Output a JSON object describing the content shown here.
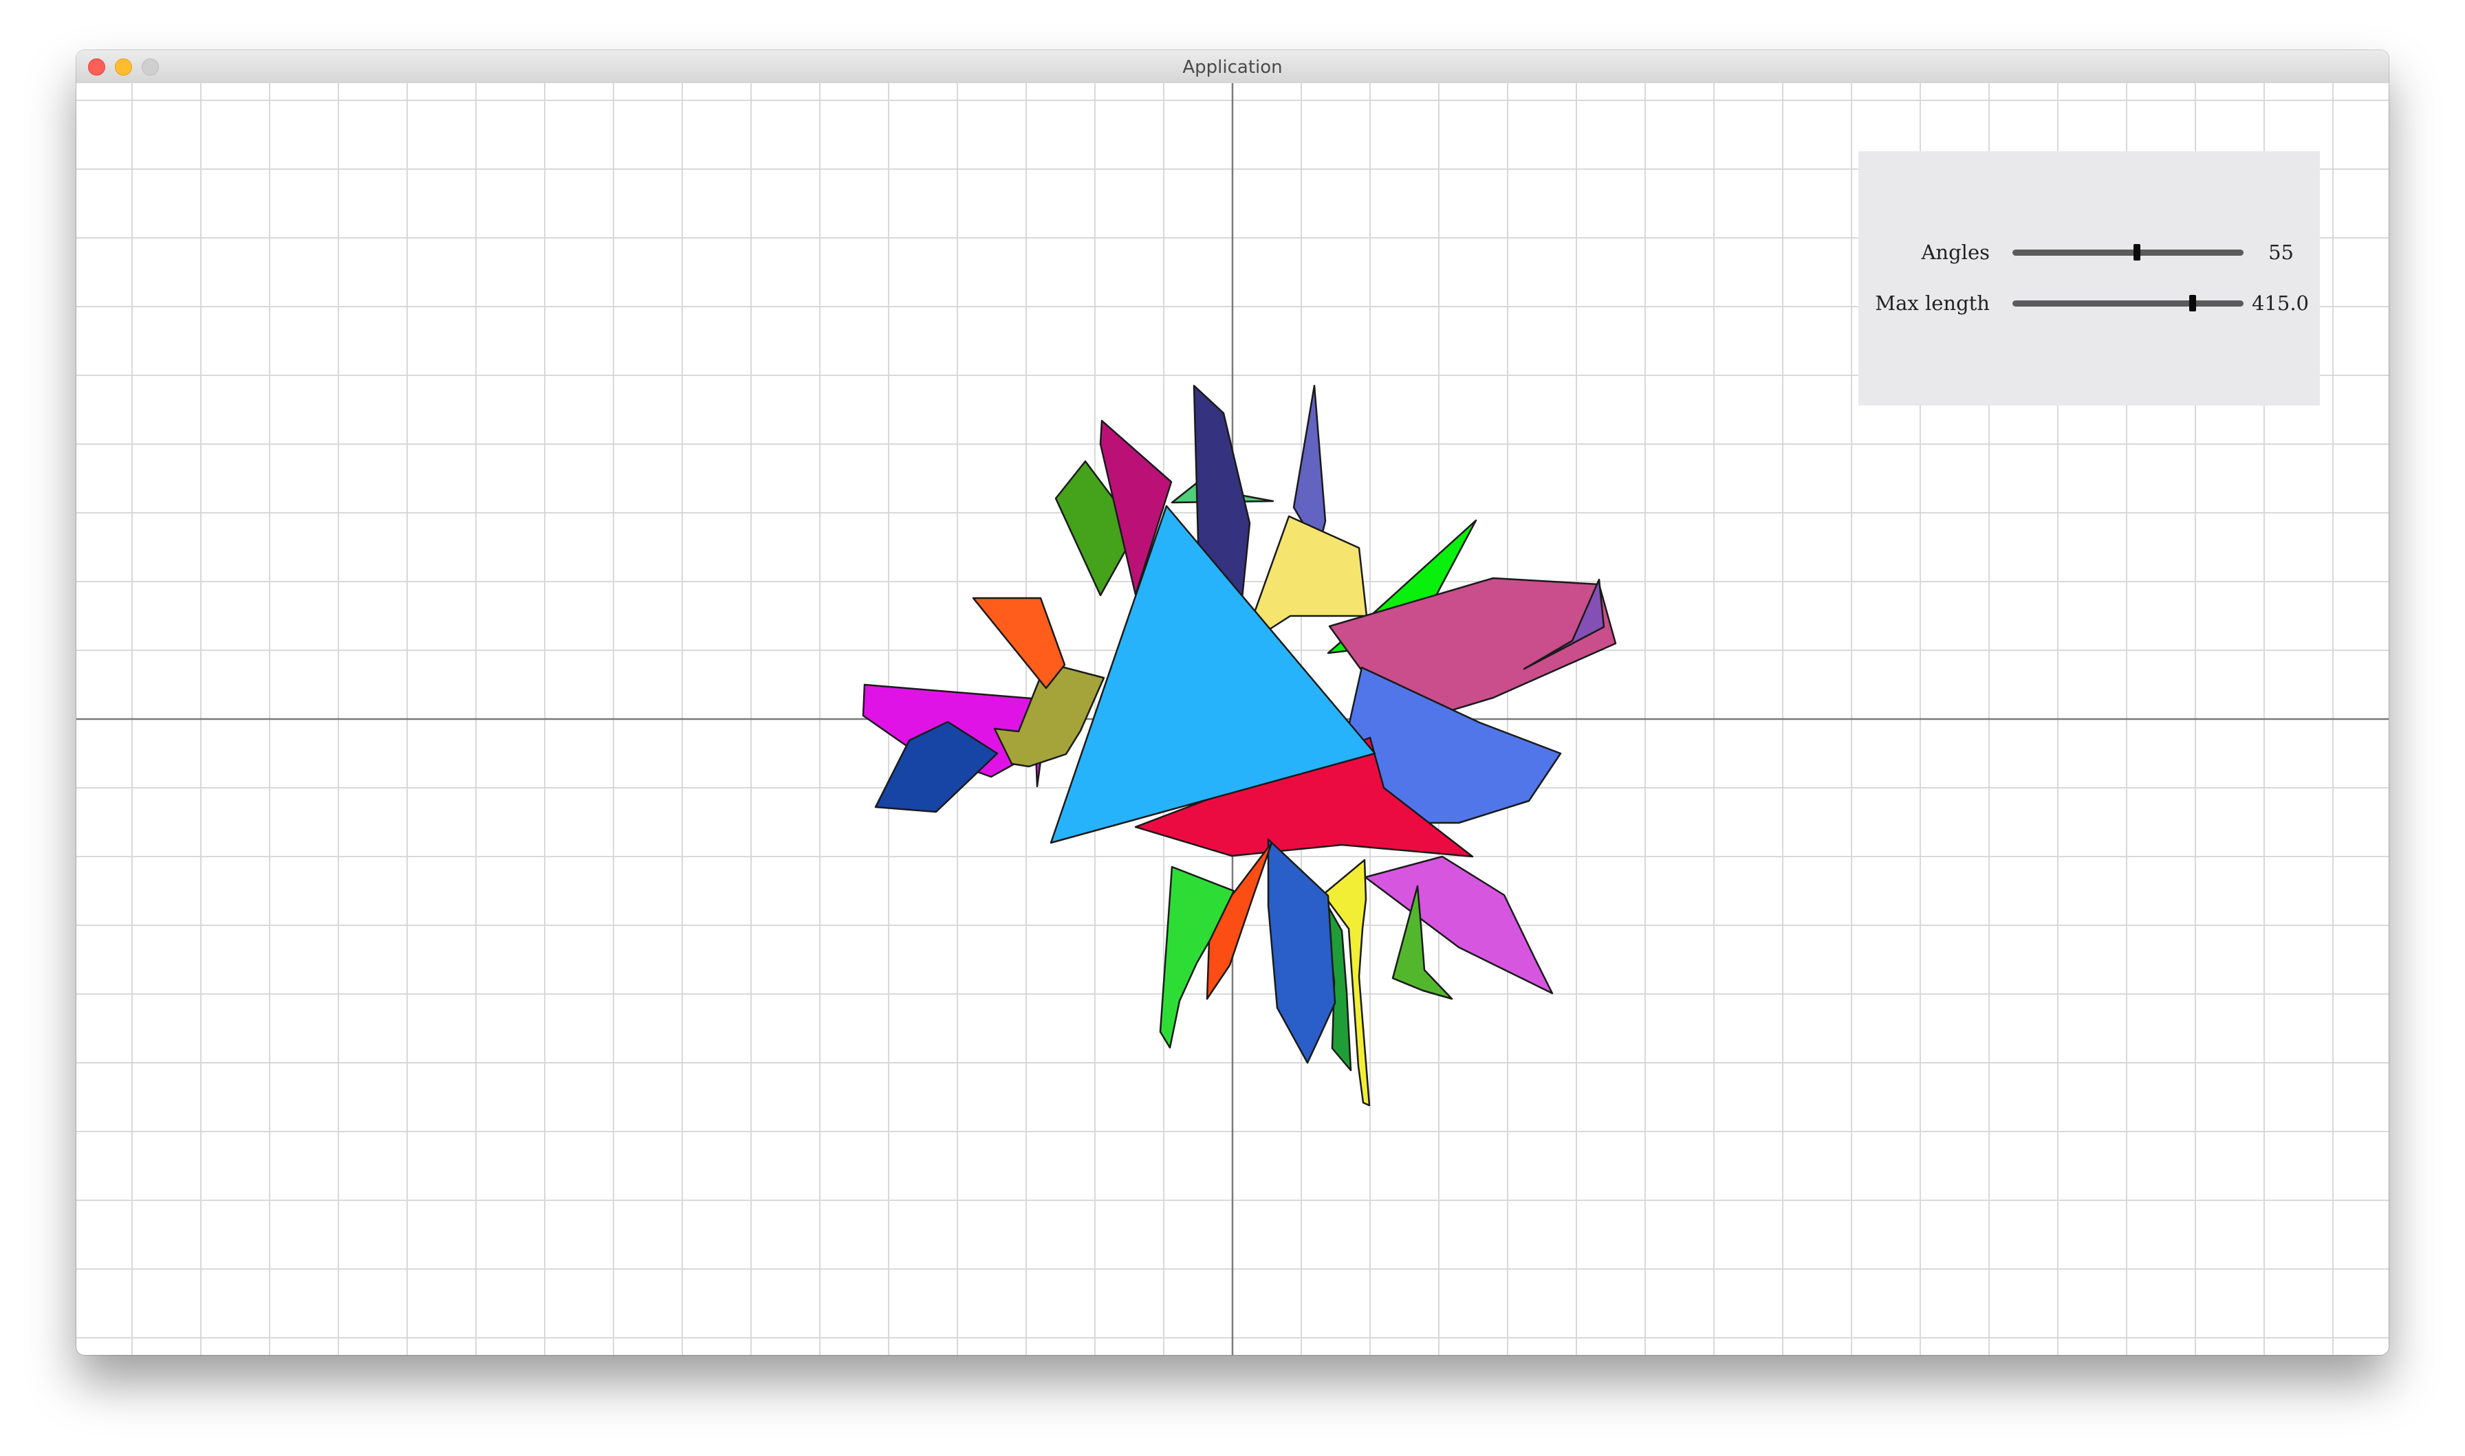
{
  "window": {
    "title": "Application"
  },
  "controls": {
    "angles": {
      "label": "Angles",
      "value": "55",
      "fraction": 0.54
    },
    "max_length": {
      "label": "Max length",
      "value": "415.0",
      "fraction": 0.78
    }
  },
  "colors": {
    "grid": "#d9d9d9",
    "axes": "#7a7a7a",
    "panel": "#e9e9eb",
    "center_triangle": "#27b3fb"
  },
  "shapes": [
    {
      "name": "magenta-shape",
      "color": "#e013e7"
    },
    {
      "name": "olive-shape",
      "color": "#a4a43a"
    },
    {
      "name": "orange-shape",
      "color": "#fe5d1b"
    },
    {
      "name": "forest-green-shape",
      "color": "#44a21b"
    },
    {
      "name": "dark-magenta-shape",
      "color": "#bb1177"
    },
    {
      "name": "mint-shape",
      "color": "#4fcf78"
    },
    {
      "name": "navy-shape",
      "color": "#35327f"
    },
    {
      "name": "slate-blue-shape",
      "color": "#6363c2"
    },
    {
      "name": "pale-yellow-shape",
      "color": "#f5e46e"
    },
    {
      "name": "bright-green-shape",
      "color": "#08f00b"
    },
    {
      "name": "pink-shape",
      "color": "#c94e8b"
    },
    {
      "name": "purple-shape",
      "color": "#8450b5"
    },
    {
      "name": "cornflower-blue-shape",
      "color": "#5076ea"
    },
    {
      "name": "crimson-shape",
      "color": "#ec0b41"
    },
    {
      "name": "orchid-shape",
      "color": "#d656e0"
    },
    {
      "name": "lime-green-shape",
      "color": "#53b72e"
    },
    {
      "name": "yellow-shape",
      "color": "#f2ee36"
    },
    {
      "name": "dark-green-shape",
      "color": "#1f9e37"
    },
    {
      "name": "royal-blue-shape",
      "color": "#2a5ec9"
    },
    {
      "name": "red-orange-shape",
      "color": "#fc4d14"
    },
    {
      "name": "green-shape",
      "color": "#2ddd35"
    },
    {
      "name": "dark-blue-shape",
      "color": "#1645a6"
    },
    {
      "name": "center-triangle",
      "color": "#27b3fb"
    }
  ]
}
